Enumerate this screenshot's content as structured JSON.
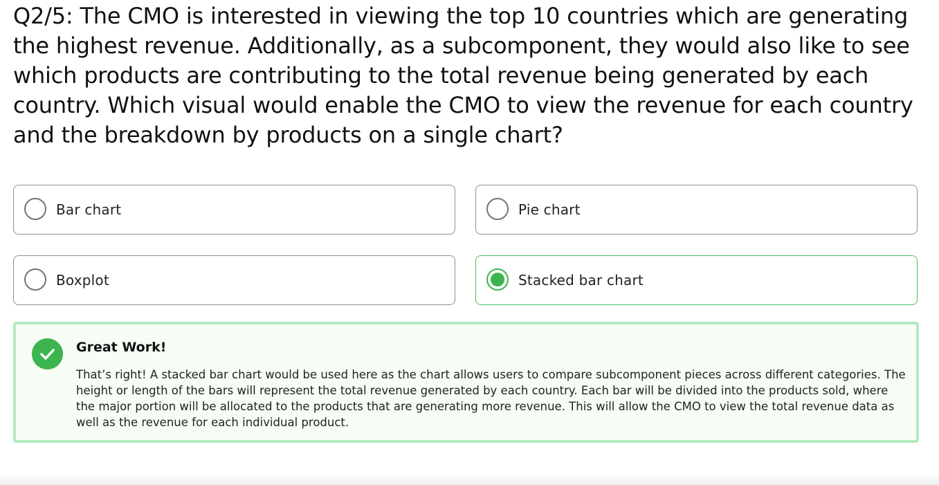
{
  "question": {
    "text": "Q2/5: The CMO is interested in viewing the top 10 countries which are generating the highest revenue. Additionally, as a subcomponent, they would also like to see which products are contributing to the total revenue being generated by each country. Which visual would enable the CMO to view the revenue for each country and the breakdown by products on a single chart?"
  },
  "options": [
    {
      "label": "Bar chart",
      "selected": false
    },
    {
      "label": "Pie chart",
      "selected": false
    },
    {
      "label": "Boxplot",
      "selected": false
    },
    {
      "label": "Stacked bar chart",
      "selected": true
    }
  ],
  "feedback": {
    "icon": "checkmark-icon",
    "title": "Great Work!",
    "text": "That’s right! A stacked bar chart would be used here as the chart allows users to compare subcomponent pieces across different categories. The height or length of the bars will represent the total revenue generated by each country. Each bar will be divided into the products sold, where the major portion will be allocated to the products that are generating more revenue. This will allow the CMO to view the total revenue data as well as the revenue for each individual product."
  },
  "colors": {
    "accent_green": "#3cb54f",
    "feedback_border": "#b3ebbd",
    "feedback_background": "#f5fdf5",
    "option_border": "#8a8f94"
  }
}
